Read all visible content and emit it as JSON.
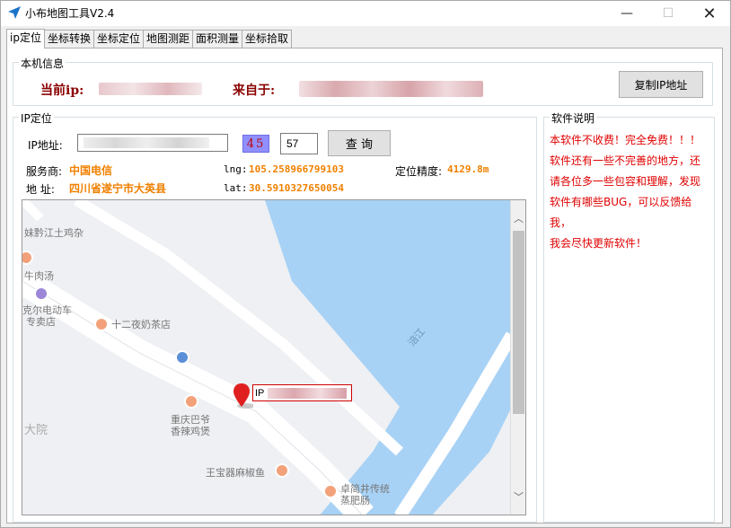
{
  "window": {
    "title": "小布地图工具V2.4",
    "min_glyph": "—",
    "max_glyph": "☐",
    "close_glyph": "✕"
  },
  "tabs": [
    {
      "label": "ip定位",
      "active": true
    },
    {
      "label": "坐标转换",
      "active": false
    },
    {
      "label": "坐标定位",
      "active": false
    },
    {
      "label": "地图测距",
      "active": false
    },
    {
      "label": "面积测量",
      "active": false
    },
    {
      "label": "坐标拾取",
      "active": false
    }
  ],
  "local_info": {
    "group_title": "本机信息",
    "ip_label": "当前ip:",
    "from_label": "来自于:",
    "copy_button": "复制IP地址"
  },
  "ip_locate": {
    "group_title": "IP定位",
    "ip_field_label": "IP地址:",
    "captcha_text": "45",
    "code_value": "57",
    "query_button": "查 询",
    "isp_label": "服务商:",
    "isp_value": "中国电信",
    "address_label": "地 址:",
    "address_value": "四川省遂宁市大英县",
    "lng_label": "lng:",
    "lng_value": "105.258966799103",
    "lat_label": "lat:",
    "lat_value": "30.5910327650054",
    "accuracy_label": "定位精度:",
    "accuracy_value": "4129.8m"
  },
  "software_note": {
    "group_title": "软件说明",
    "lines": [
      "本软件不收费！完全免费！！！",
      "软件还有一些不完善的地方，还",
      "请各位多一些包容和理解，发现",
      "软件有哪些BUG，可以反馈给我，",
      "我会尽快更新软件！"
    ]
  },
  "map": {
    "pois": [
      "妹黔江土鸡杂",
      "牛肉汤",
      "克尔电动车",
      "专卖店",
      "十二夜奶茶店",
      "涪江",
      "重庆巴爷",
      "香辣鸡煲",
      "大院",
      "王宝器麻椒鱼",
      "卓简井传统",
      "蒸肥肠"
    ],
    "marker_label": "IP",
    "up_arrow": "︿",
    "down_arrow": "﹀"
  },
  "colors": {
    "accent_red": "#8b0000",
    "value_orange": "#f08000",
    "note_red": "#e00000",
    "water": "#a8d2f5",
    "marker": "#e02020"
  }
}
